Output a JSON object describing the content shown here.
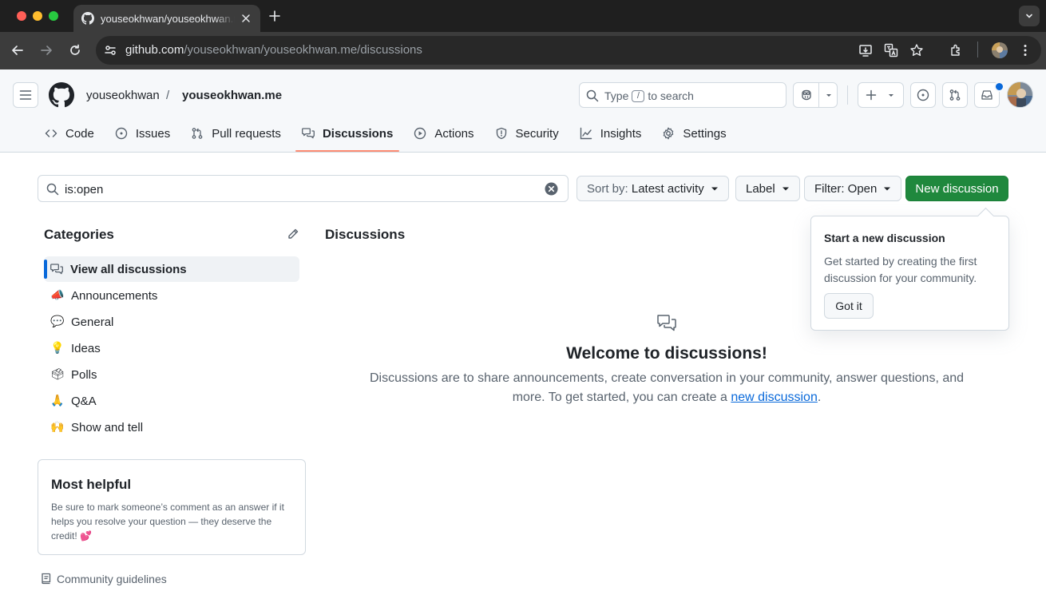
{
  "browser": {
    "tab_title": "youseokhwan/youseokhwan.me",
    "url_host": "github.com",
    "url_path": "/youseokhwan/youseokhwan.me/discussions"
  },
  "header": {
    "owner": "youseokhwan",
    "separator": "/",
    "repo": "youseokhwan.me",
    "search_prefix": "Type",
    "search_key": "/",
    "search_suffix": "to search"
  },
  "repo_nav": [
    {
      "label": "Code",
      "icon": "code-icon"
    },
    {
      "label": "Issues",
      "icon": "issue-icon"
    },
    {
      "label": "Pull requests",
      "icon": "pull-request-icon"
    },
    {
      "label": "Discussions",
      "icon": "comment-discussion-icon",
      "selected": true
    },
    {
      "label": "Actions",
      "icon": "play-icon"
    },
    {
      "label": "Security",
      "icon": "shield-icon"
    },
    {
      "label": "Insights",
      "icon": "graph-icon"
    },
    {
      "label": "Settings",
      "icon": "gear-icon"
    }
  ],
  "filters": {
    "query": "is:open",
    "sort_prefix": "Sort by:",
    "sort_value": "Latest activity",
    "label": "Label",
    "filter": "Filter: Open",
    "new_discussion": "New discussion"
  },
  "sidebar": {
    "title": "Categories",
    "items": [
      {
        "label": "View all discussions",
        "emoji": "comment-discussion-icon",
        "active": true
      },
      {
        "label": "Announcements",
        "emoji": "📣"
      },
      {
        "label": "General",
        "emoji": "💬"
      },
      {
        "label": "Ideas",
        "emoji": "💡"
      },
      {
        "label": "Polls",
        "emoji": "🗳"
      },
      {
        "label": "Q&A",
        "emoji": "🙏"
      },
      {
        "label": "Show and tell",
        "emoji": "🙌"
      }
    ],
    "helpful_title": "Most helpful",
    "helpful_body": "Be sure to mark someone’s comment as an answer if it helps you resolve your question — they deserve the credit! 💕",
    "guidelines": "Community guidelines"
  },
  "main": {
    "title": "Discussions",
    "welcome": "Welcome to discussions!",
    "desc_before": "Discussions are to share announcements, create conversation in your community, answer questions, and more. To get started, you can create a",
    "desc_link": "new discussion",
    "desc_after": "."
  },
  "popover": {
    "title": "Start a new discussion",
    "body": "Get started by creating the first discussion for your community.",
    "button": "Got it"
  },
  "colors": {
    "accent": "#0969da",
    "primary_button": "#1f883d",
    "selected_tab_underline": "#fd8c73",
    "notification_dot": "#0969da"
  }
}
